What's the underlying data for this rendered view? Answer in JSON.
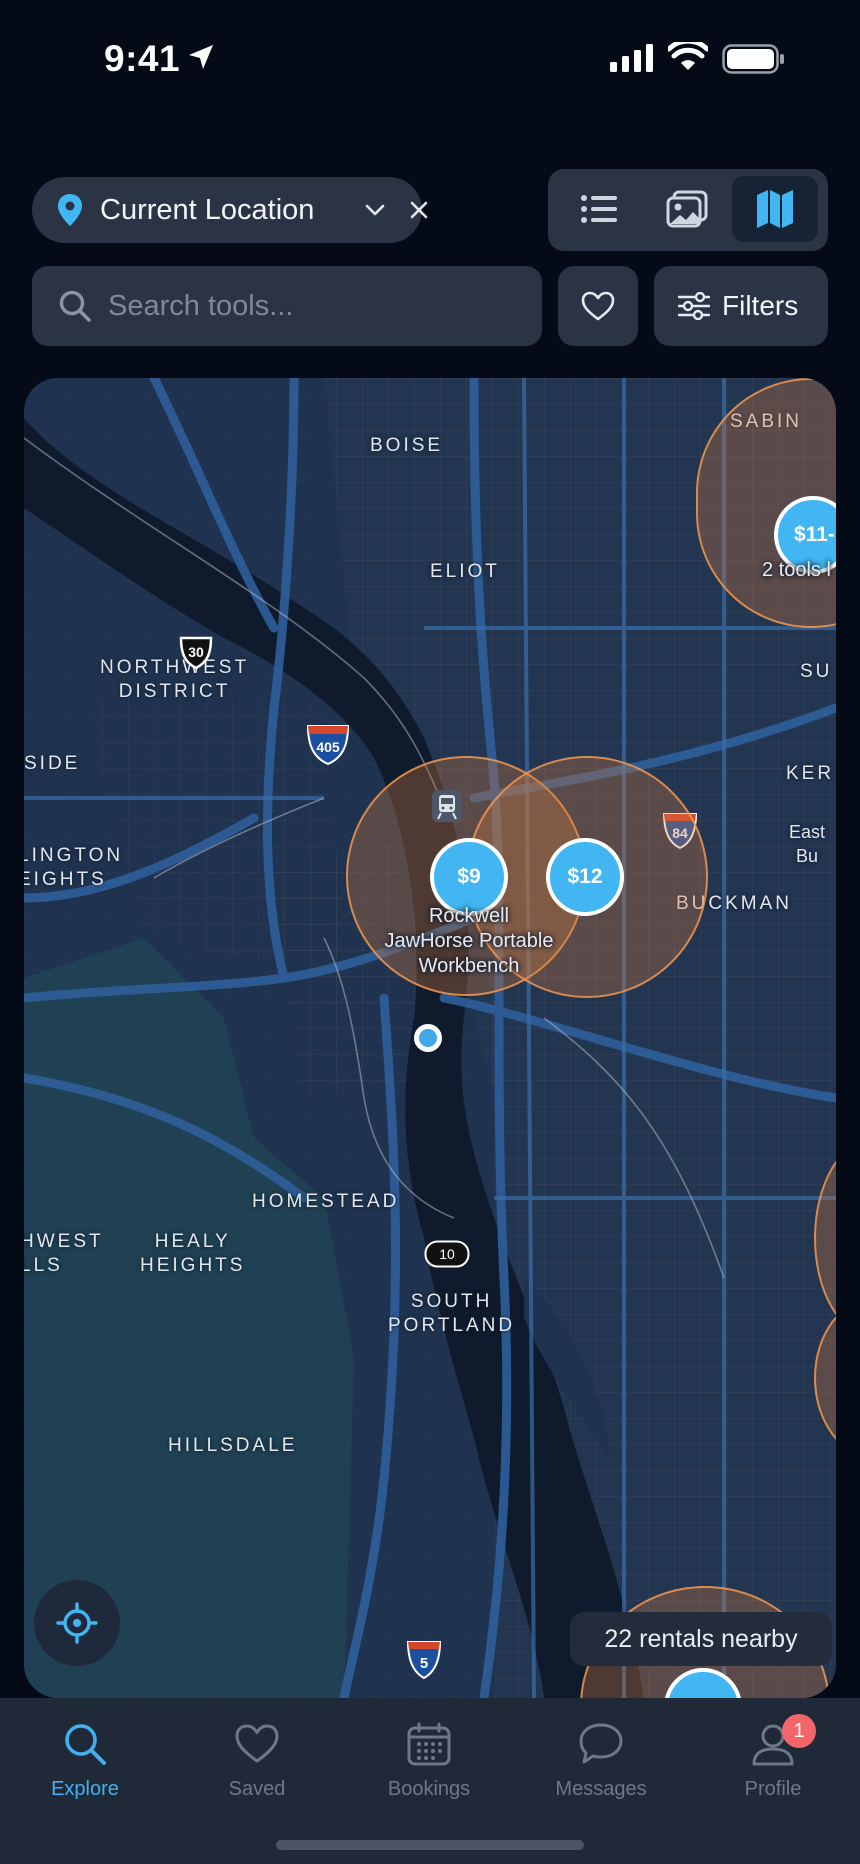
{
  "status_bar": {
    "time": "9:41"
  },
  "top_bar": {
    "location": "Current Location",
    "view_modes": [
      "list",
      "gallery",
      "map"
    ],
    "active_view": "map"
  },
  "search": {
    "placeholder": "Search tools..."
  },
  "filters": {
    "label": "Filters"
  },
  "map": {
    "area_labels": {
      "boise": "BOISE",
      "sabin": "SABIN",
      "eliot": "ELIOT",
      "northwest_district": "NORTHWEST\nDISTRICT",
      "side": "SIDE",
      "su": "SU",
      "kerr": "KER",
      "east_bu": "East Bu",
      "arlington": "LINGTON\nEIGHTS",
      "buckman": "BUCKMAN",
      "hwest": "HWEST\nLLS",
      "homestead": "HOMESTEAD",
      "healy": "HEALY\nHEIGHTS",
      "south_portland": "SOUTH\nPORTLAND",
      "hillsdale": "HILLSDALE"
    },
    "highway_shields": {
      "us30": "30",
      "i405": "405",
      "i84": "84",
      "or10": "10",
      "i5": "5"
    },
    "pins": [
      {
        "price": "$9"
      },
      {
        "price": "$12"
      },
      {
        "price": "$11-"
      }
    ],
    "tool_label": "Rockwell\nJawHorse Portable\nWorkbench",
    "cluster_label": "2 tools l",
    "rentals_nearby": "22 rentals nearby"
  },
  "tabs": [
    {
      "label": "Explore",
      "icon": "search-icon",
      "active": true
    },
    {
      "label": "Saved",
      "icon": "heart-icon",
      "active": false
    },
    {
      "label": "Bookings",
      "icon": "calendar-icon",
      "active": false
    },
    {
      "label": "Messages",
      "icon": "chat-icon",
      "active": false
    },
    {
      "label": "Profile",
      "icon": "profile-icon",
      "active": false,
      "badge": "1"
    }
  ],
  "colors": {
    "accent": "#42B6F2",
    "radius": "#CE783C",
    "badge": "#F2666A"
  }
}
